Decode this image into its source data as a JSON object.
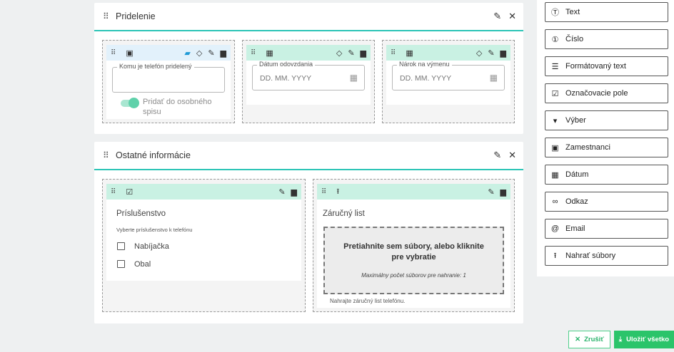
{
  "sections": {
    "assignment": {
      "title": "Pridelenie",
      "fields": {
        "phone_assigned": {
          "legend": "Komu je telefón pridelený",
          "toggle_label": "Pridať do osobného spisu"
        },
        "return_date": {
          "legend": "Dátum odovzdania",
          "placeholder": "DD. MM. YYYY"
        },
        "exchange_entitlement": {
          "legend": "Nárok na výmenu",
          "placeholder": "DD. MM. YYYY"
        }
      }
    },
    "other_info": {
      "title": "Ostatné informácie",
      "fields": {
        "accessories": {
          "label": "Príslušenstvo",
          "help": "Vyberte príslušenstvo k telefónu",
          "options": [
            "Nabíjačka",
            "Obal"
          ]
        },
        "warranty": {
          "label": "Záručný list",
          "dropzone_title": "Pretiahnite sem súbory, alebo kliknite pre vybratie",
          "dropzone_sub": "Maximálny počet súborov pre nahranie: 1",
          "help": "Nahrajte záručný list telefónu."
        }
      }
    }
  },
  "palette": {
    "items": [
      {
        "label": "Text",
        "icon": "text-field-icon"
      },
      {
        "label": "Číslo",
        "icon": "number-icon"
      },
      {
        "label": "Formátovaný text",
        "icon": "formatted-text-icon"
      },
      {
        "label": "Označovacie pole",
        "icon": "checkbox-icon"
      },
      {
        "label": "Výber",
        "icon": "select-icon"
      },
      {
        "label": "Zamestnanci",
        "icon": "employee-icon"
      },
      {
        "label": "Dátum",
        "icon": "calendar-icon"
      },
      {
        "label": "Odkaz",
        "icon": "link-icon"
      },
      {
        "label": "Email",
        "icon": "at-icon"
      },
      {
        "label": "Nahrať súbory",
        "icon": "upload-icon"
      }
    ]
  },
  "actions": {
    "cancel_label": "Zrušiť",
    "save_label": "Uložiť všetko"
  },
  "colors": {
    "accent": "#2bc4b6",
    "toolbar_green": "#c9f1e3",
    "toolbar_blue": "#e2f1fb",
    "save_green": "#2bc46a"
  }
}
